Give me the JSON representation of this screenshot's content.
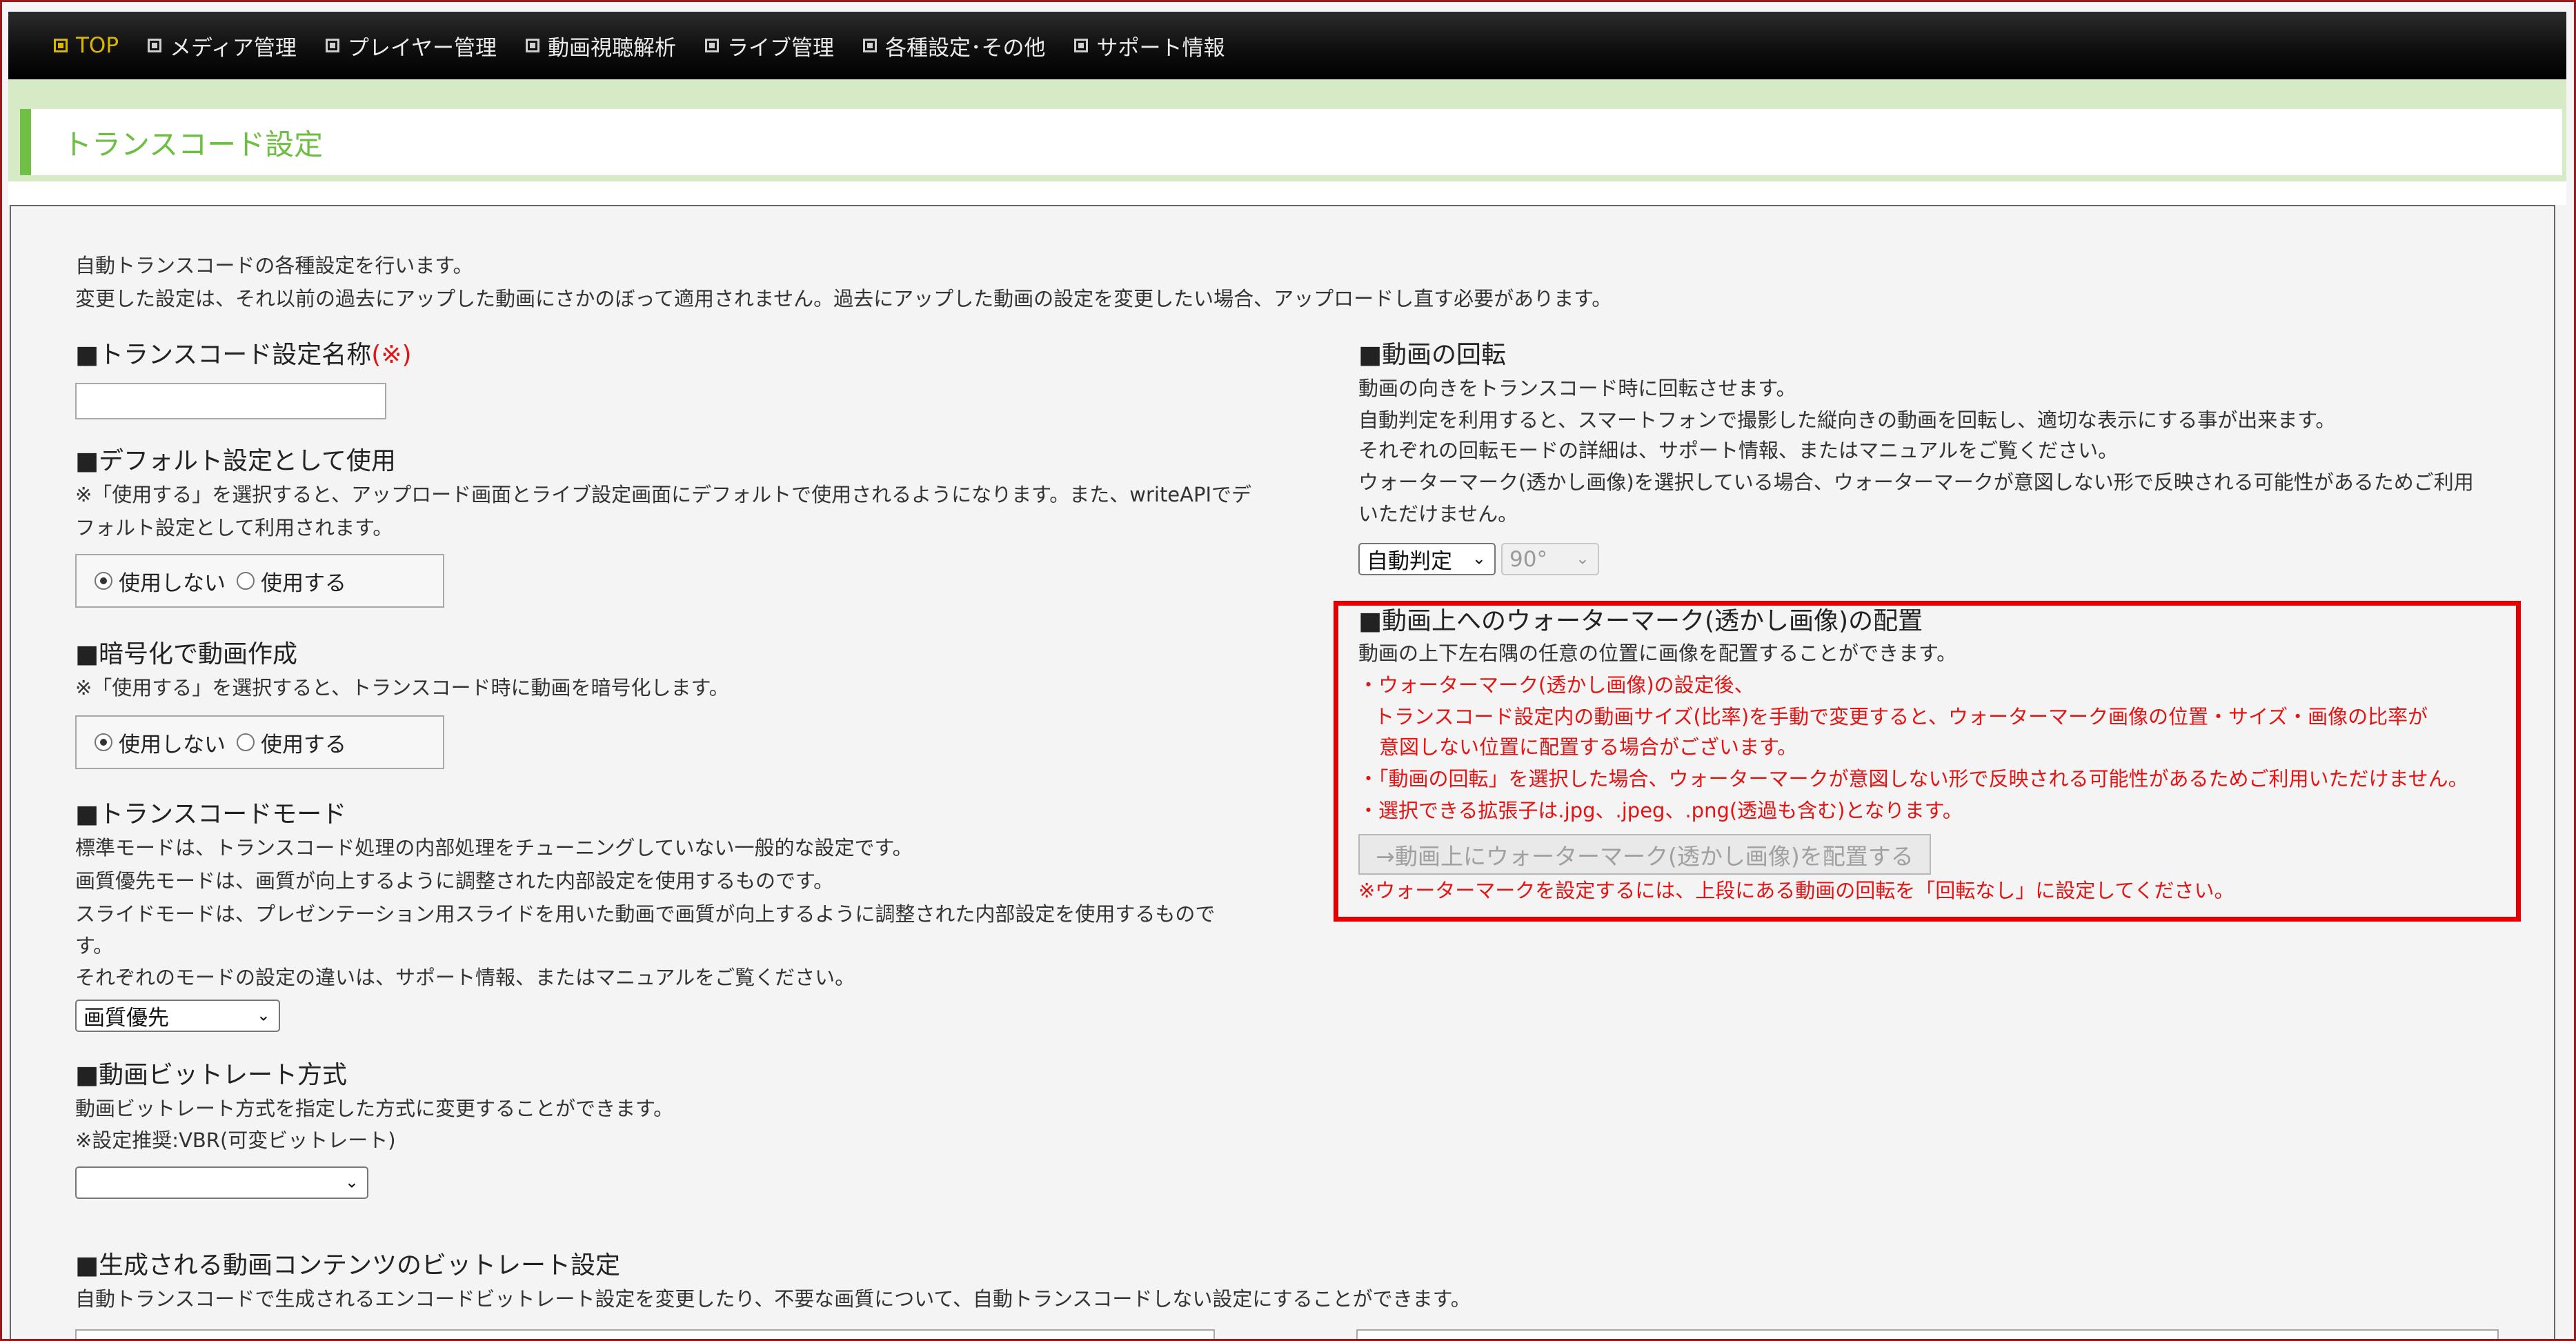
{
  "nav": {
    "items": [
      {
        "label": "TOP",
        "active": true
      },
      {
        "label": "メディア管理",
        "active": false
      },
      {
        "label": "プレイヤー管理",
        "active": false
      },
      {
        "label": "動画視聴解析",
        "active": false
      },
      {
        "label": "ライブ管理",
        "active": false
      },
      {
        "label": "各種設定･その他",
        "active": false
      },
      {
        "label": "サポート情報",
        "active": false
      }
    ]
  },
  "page": {
    "title": "トランスコード設定"
  },
  "intro": {
    "line1": "自動トランスコードの各種設定を行います。",
    "line2": "変更した設定は、それ以前の過去にアップした動画にさかのぼって適用されません。過去にアップした動画の設定を変更したい場合、アップロードし直す必要があります。"
  },
  "name_section": {
    "heading": "■トランスコード設定名称",
    "required_mark": "(※)",
    "value": ""
  },
  "default_section": {
    "heading": "■デフォルト設定として使用",
    "desc1": "※「使用する」を選択すると、アップロード画面とライブ設定画面にデフォルトで使用されるようになります。また、writeAPIでデ",
    "desc2": "フォルト設定として利用されます。",
    "opt_no": "使用しない",
    "opt_yes": "使用する",
    "selected": "使用しない"
  },
  "encrypt_section": {
    "heading": "■暗号化で動画作成",
    "desc": "※「使用する」を選択すると、トランスコード時に動画を暗号化します。",
    "opt_no": "使用しない",
    "opt_yes": "使用する",
    "selected": "使用しない"
  },
  "mode_section": {
    "heading": "■トランスコードモード",
    "line1": "標準モードは、トランスコード処理の内部処理をチューニングしていない一般的な設定です。",
    "line2": "画質優先モードは、画質が向上するように調整された内部設定を使用するものです。",
    "line3": "スライドモードは、プレゼンテーション用スライドを用いた動画で画質が向上するように調整された内部設定を使用するもので",
    "line4": "す。",
    "line5": "それぞれのモードの設定の違いは、サポート情報、またはマニュアルをご覧ください。",
    "selected": "画質優先"
  },
  "bitrate_section": {
    "heading": "■動画ビットレート方式",
    "line1": "動画ビットレート方式を指定した方式に変更することができます。",
    "line2": "※設定推奨:VBR(可変ビットレート)",
    "selected": ""
  },
  "content_bitrate_section": {
    "heading": "■生成される動画コンテンツのビットレート設定",
    "line1": "自動トランスコードで生成されるエンコードビットレート設定を変更したり、不要な画質について、自動トランスコードしない設定にすることができます。"
  },
  "rotation_section": {
    "heading": "■動画の回転",
    "line1": "動画の向きをトランスコード時に回転させます。",
    "line2": "自動判定を利用すると、スマートフォンで撮影した縦向きの動画を回転し、適切な表示にする事が出来ます。",
    "line3": "それぞれの回転モードの詳細は、サポート情報、またはマニュアルをご覧ください。",
    "line4": "ウォーターマーク(透かし画像)を選択している場合、ウォーターマークが意図しない形で反映される可能性があるためご利用",
    "line5": "いただけません。",
    "mode_selected": "自動判定",
    "angle_selected": "90°"
  },
  "watermark_section": {
    "heading": "■動画上へのウォーターマーク(透かし画像)の配置",
    "line1": "動画の上下左右隅の任意の位置に画像を配置することができます。",
    "note1": "・ウォーターマーク(透かし画像)の設定後、",
    "note2": "トランスコード設定内の動画サイズ(比率)を手動で変更すると、ウォーターマーク画像の位置・サイズ・画像の比率が",
    "note3": "意図しない位置に配置する場合がございます。",
    "note4": "・「動画の回転」を選択した場合、ウォーターマークが意図しない形で反映される可能性があるためご利用いただけません。",
    "note5": "・選択できる拡張子は.jpg、.jpeg、.png(透過も含む)となります。",
    "button_label": "→動画上にウォーターマーク(透かし画像)を配置する",
    "warning": "※ウォーターマークを設定するには、上段にある動画の回転を「回転なし」に設定してください。"
  },
  "colors": {
    "accent_green": "#6fbe44",
    "warning_red": "#e31414",
    "nav_active": "#d9b600"
  },
  "icons": {
    "nav_item": "checkbox-icon",
    "select_arrow": "chevron-down-icon"
  }
}
